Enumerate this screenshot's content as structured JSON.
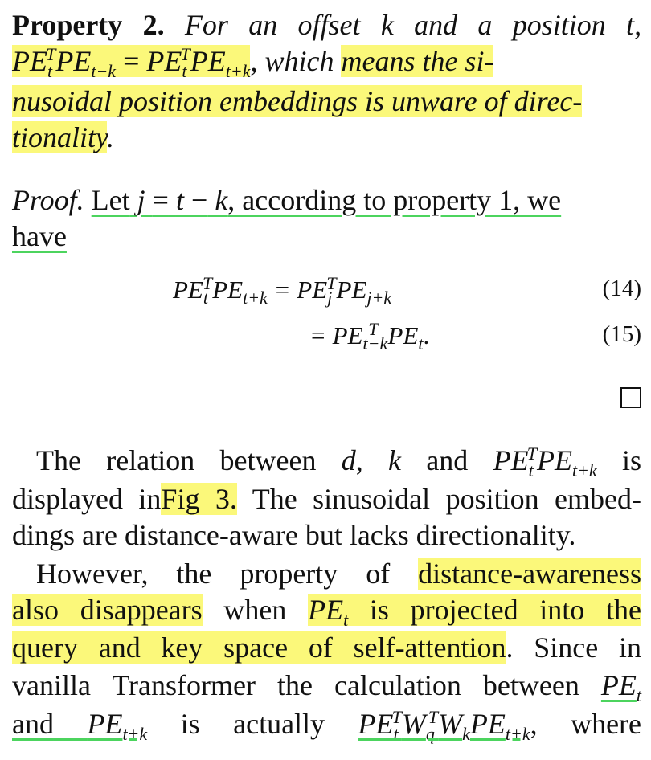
{
  "property": {
    "label": "Property 2.",
    "statement_a": "For an offset",
    "k1": "k",
    "statement_b": "and a position",
    "t1": "t",
    "comma": ",",
    "eq_lhs": "PE",
    "eq_mid": "PE",
    "eq_eq": "=",
    "eq_rhs1": "PE",
    "eq_rhs2": "PE",
    "which": ", which",
    "means1": "means the si-",
    "means2": "nusoidal position embeddings is unware of direc-",
    "means3": "tionality",
    "period": "."
  },
  "proof": {
    "label": "Proof.",
    "let_text": "Let",
    "j": "j",
    "eqs": "=",
    "t": "t",
    "minus": "−",
    "k": "k",
    "rest": ", according to property 1, we",
    "have": "have"
  },
  "equations": {
    "eq14_lhs": "PE",
    "eq14_rhs": "= PE",
    "eq14_num": "(14)",
    "eq15_rhs": "= PE",
    "eq15_num": "(15)"
  },
  "para1": {
    "l1a": "The relation between",
    "d": "d",
    "l1b": ",",
    "k": "k",
    "l1c": "and",
    "l1d": "is",
    "l2a": "displayed in",
    "fig": "Fig 3.",
    "l2b": "The sinusoidal position embed-",
    "l3": "dings are distance-aware but lacks directionality."
  },
  "para2": {
    "l1a": "However, the property of",
    "l1hl": "distance-awareness",
    "l2hl": "also disappears",
    "l2b": "when",
    "l2hl2": "is projected into the",
    "l3hl": "query and key space of self-attention",
    "l3b": ". Since in",
    "l4a": "vanilla Transformer the calculation between",
    "l5a": "and",
    "l5b": "is actually",
    "l5c": ", where"
  }
}
